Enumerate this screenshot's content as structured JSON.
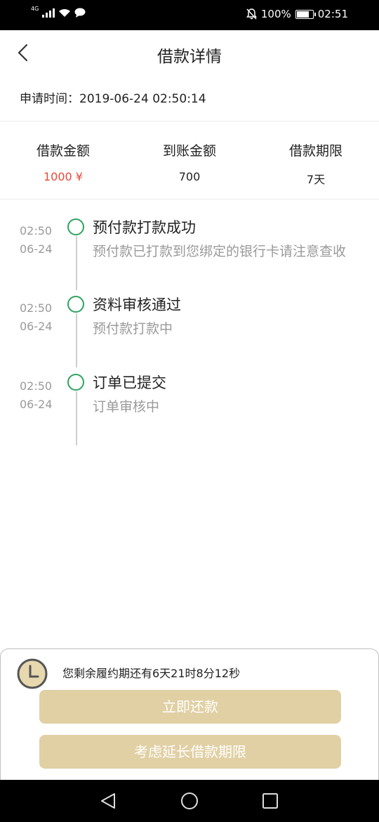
{
  "status_bar": {
    "network_type": "4G",
    "battery_percent": "100%",
    "time": "02:51",
    "icons": [
      "signal-icon",
      "wifi-icon",
      "message-icon",
      "mute-icon",
      "battery-icon"
    ]
  },
  "header": {
    "title": "借款详情",
    "back_icon": "chevron-left-icon"
  },
  "apply_time": {
    "label": "申请时间：",
    "value": "2019-06-24 02:50:14"
  },
  "summary": [
    {
      "label": "借款金额",
      "value": "1000 ¥",
      "color": "#e8493a"
    },
    {
      "label": "到账金额",
      "value": "700"
    },
    {
      "label": "借款期限",
      "value": "7天"
    }
  ],
  "timeline": [
    {
      "time": "02:50",
      "date": "06-24",
      "title": "预付款打款成功",
      "desc": "预付款已打款到您绑定的银行卡请注意查收"
    },
    {
      "time": "02:50",
      "date": "06-24",
      "title": "资料审核通过",
      "desc": "预付款打款中"
    },
    {
      "time": "02:50",
      "date": "06-24",
      "title": "订单已提交",
      "desc": "订单审核中"
    }
  ],
  "bottom": {
    "clock_icon": "clock-icon",
    "remaining_text": "您剩余履约期还有6天21时8分12秒",
    "repay_button": "立即还款",
    "extend_button": "考虑延长借款期限",
    "button_color": "#e1d0a4"
  },
  "nav_bar": {
    "icons": [
      "back-triangle-icon",
      "home-circle-icon",
      "recents-square-icon"
    ]
  },
  "colors": {
    "accent_green": "#2ea35f",
    "amount_red": "#e8493a",
    "muted_text": "#9a9a9a"
  }
}
